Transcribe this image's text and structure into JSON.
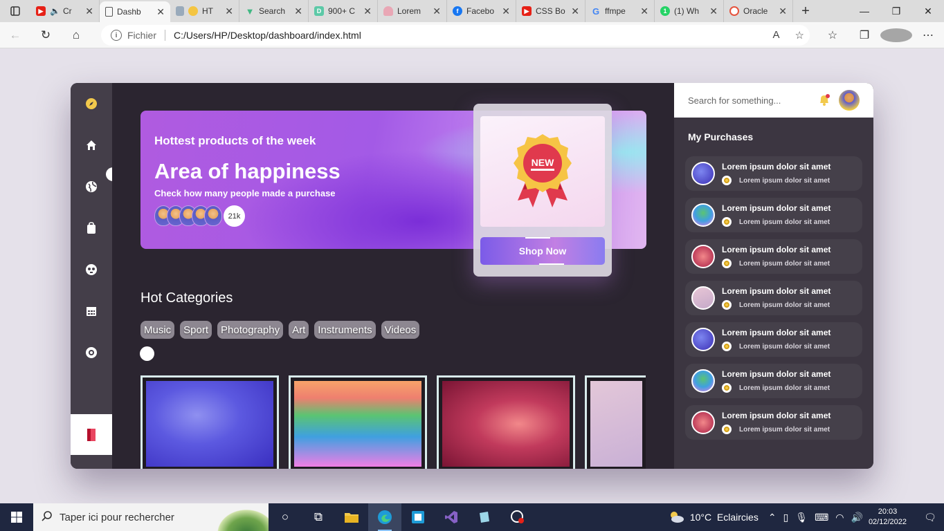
{
  "browser": {
    "tabs": [
      {
        "title": "Cr",
        "favicon": "youtube-icon",
        "color": "#e62117",
        "muted": true
      },
      {
        "title": "Dashb",
        "favicon": "page-icon",
        "active": true
      },
      {
        "title": "HT",
        "favicon": "html-icon"
      },
      {
        "title": "Search",
        "favicon": "vue-icon",
        "color": "#41b883"
      },
      {
        "title": "900+ C",
        "favicon": "d-icon",
        "color": "#5cc9a7"
      },
      {
        "title": "Lorem",
        "favicon": "figure-icon"
      },
      {
        "title": "Facebo",
        "favicon": "facebook-icon",
        "color": "#1877f2"
      },
      {
        "title": "CSS Bo",
        "favicon": "youtube-icon",
        "color": "#e62117"
      },
      {
        "title": "ffmpe",
        "favicon": "google-icon"
      },
      {
        "title": "(1) Wh",
        "favicon": "whatsapp-icon",
        "color": "#25d366"
      },
      {
        "title": "Oracle",
        "favicon": "oracle-icon"
      }
    ],
    "address": {
      "scheme_label": "Fichier",
      "url": "C:/Users/HP/Desktop/dashboard/index.html"
    }
  },
  "hero": {
    "subtitle": "Hottest products of the week",
    "title": "Area of happiness",
    "description": "Check how many people made a purchase",
    "buyers_count": "21k",
    "badge_text": "NEW",
    "shop_button": "Shop Now"
  },
  "categories": {
    "title": "Hot Categories",
    "chips": [
      "Music",
      "Sport",
      "Photography",
      "Art",
      "Instruments",
      "Videos"
    ]
  },
  "search": {
    "placeholder": "Search for something..."
  },
  "purchases": {
    "title": "My Purchases",
    "items": [
      {
        "title": "Lorem ipsum dolor sit amet",
        "subtitle": "Lorem ipsum dolor sit amet"
      },
      {
        "title": "Lorem ipsum dolor sit amet",
        "subtitle": "Lorem ipsum dolor sit amet"
      },
      {
        "title": "Lorem ipsum dolor sit amet",
        "subtitle": "Lorem ipsum dolor sit amet"
      },
      {
        "title": "Lorem ipsum dolor sit amet",
        "subtitle": "Lorem ipsum dolor sit amet"
      },
      {
        "title": "Lorem ipsum dolor sit amet",
        "subtitle": "Lorem ipsum dolor sit amet"
      },
      {
        "title": "Lorem ipsum dolor sit amet",
        "subtitle": "Lorem ipsum dolor sit amet"
      },
      {
        "title": "Lorem ipsum dolor sit amet",
        "subtitle": "Lorem ipsum dolor sit amet"
      }
    ]
  },
  "taskbar": {
    "search_placeholder": "Taper ici pour rechercher",
    "weather": "10°C  Eclaircies",
    "time": "20:03",
    "date": "02/12/2022"
  },
  "colors": {
    "accent": "#a35ae6",
    "panel": "#3c3641",
    "background": "#2b2530",
    "sidebar": "#443e49"
  }
}
